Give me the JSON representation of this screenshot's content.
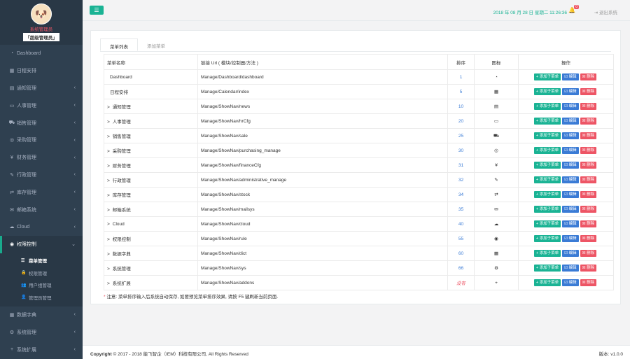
{
  "profile": {
    "name": "系统管理员",
    "role": "「超级管理员」"
  },
  "sidebar": {
    "items": [
      {
        "label": "Dashboard",
        "icon": "dashboard-icon",
        "glyph": "◔",
        "chevron": ""
      },
      {
        "label": "日程安排",
        "icon": "calendar-icon",
        "glyph": "▦",
        "chevron": ""
      },
      {
        "label": "通知管理",
        "icon": "news-icon",
        "glyph": "▤",
        "chevron": "‹"
      },
      {
        "label": "人事管理",
        "icon": "id-card-icon",
        "glyph": "▭",
        "chevron": "‹"
      },
      {
        "label": "销售管理",
        "icon": "cart-icon",
        "glyph": "⛟",
        "chevron": "‹"
      },
      {
        "label": "采购管理",
        "icon": "target-icon",
        "glyph": "◎",
        "chevron": "‹"
      },
      {
        "label": "财务管理",
        "icon": "yen-icon",
        "glyph": "¥",
        "chevron": "‹"
      },
      {
        "label": "行政管理",
        "icon": "plug-icon",
        "glyph": "✎",
        "chevron": "‹"
      },
      {
        "label": "库存管理",
        "icon": "retweet-icon",
        "glyph": "⇄",
        "chevron": "‹"
      },
      {
        "label": "邮箱系统",
        "icon": "envelope-icon",
        "glyph": "✉",
        "chevron": "‹"
      },
      {
        "label": "Cloud",
        "icon": "cloud-icon",
        "glyph": "☁",
        "chevron": "‹"
      },
      {
        "label": "权限控制",
        "icon": "shield-icon",
        "glyph": "◉",
        "chevron": "⌄"
      }
    ],
    "sub_items": [
      {
        "label": "菜单管理",
        "glyph": "☰"
      },
      {
        "label": "权限管理",
        "glyph": "🔒"
      },
      {
        "label": "用户组管理",
        "glyph": "👥"
      },
      {
        "label": "管理员管理",
        "glyph": "👤"
      }
    ],
    "bottom_items": [
      {
        "label": "数据字典",
        "glyph": "▦",
        "chevron": "‹"
      },
      {
        "label": "系统管理",
        "glyph": "⚙",
        "chevron": "‹"
      },
      {
        "label": "系统扩展",
        "glyph": "+",
        "chevron": "‹"
      }
    ]
  },
  "topbar": {
    "menu_glyph": "☰",
    "datetime": "2018 年 08 月 28 日 星期二 11:26:36",
    "badge": "0",
    "logout": "退出系统"
  },
  "tabs": [
    "菜单列表",
    "添加菜单"
  ],
  "table": {
    "headers": [
      "菜单名称",
      "链接 Url ( 模块/控制器/方法 )",
      "排序",
      "图标",
      "操作"
    ],
    "rows": [
      {
        "name": "Dashboard",
        "url": "Manage/Dashboard/dashboard",
        "sort": "1",
        "icon": "◔",
        "arrow": ""
      },
      {
        "name": "日程安排",
        "url": "Manage/Calendar/index",
        "sort": "5",
        "icon": "▦",
        "arrow": ""
      },
      {
        "name": "通知管理",
        "url": "Manage/ShowNav/news",
        "sort": "10",
        "icon": "▤",
        "arrow": ">"
      },
      {
        "name": "人事管理",
        "url": "Manage/ShowNav/hrCfg",
        "sort": "20",
        "icon": "▭",
        "arrow": ">"
      },
      {
        "name": "销售管理",
        "url": "Manage/ShowNav/sale",
        "sort": "25",
        "icon": "⛟",
        "arrow": ">"
      },
      {
        "name": "采购管理",
        "url": "Manage/ShowNav/purchasing_manage",
        "sort": "30",
        "icon": "◎",
        "arrow": ">"
      },
      {
        "name": "财务管理",
        "url": "Manage/ShowNav/financeCfg",
        "sort": "31",
        "icon": "¥",
        "arrow": ">"
      },
      {
        "name": "行政管理",
        "url": "Manage/ShowNav/administrative_manage",
        "sort": "32",
        "icon": "✎",
        "arrow": ">"
      },
      {
        "name": "库存管理",
        "url": "Manage/ShowNav/stock",
        "sort": "34",
        "icon": "⇄",
        "arrow": ">"
      },
      {
        "name": "邮箱系统",
        "url": "Manage/ShowNav/mailsys",
        "sort": "35",
        "icon": "✉",
        "arrow": ">"
      },
      {
        "name": "Cloud",
        "url": "Manage/ShowNav/cloud",
        "sort": "40",
        "icon": "☁",
        "arrow": ">"
      },
      {
        "name": "权限控制",
        "url": "Manage/ShowNav/rule",
        "sort": "55",
        "icon": "◉",
        "arrow": ">"
      },
      {
        "name": "数据字典",
        "url": "Manage/ShowNav/dict",
        "sort": "60",
        "icon": "▦",
        "arrow": ">"
      },
      {
        "name": "系统管理",
        "url": "Manage/ShowNav/sys",
        "sort": "66",
        "icon": "⚙",
        "arrow": ">"
      },
      {
        "name": "系统扩展",
        "url": "Manage/ShowNav/addons",
        "sort": "没有",
        "icon": "+",
        "arrow": ">"
      }
    ],
    "actions": {
      "add": "+ 添加子菜单",
      "edit": "☑ 编辑",
      "delete": "☒ 删除"
    }
  },
  "note": {
    "star": "*",
    "text": " 注意: 菜单排序输入后系统自动保存, 如要预览菜单排序效果, 请按 F5 键刷新当前页面."
  },
  "footer": {
    "copyright_bold": "Copyright",
    "copyright": " © 2017 - 2018 能飞智企（IEM）科技有限公司, All Rights Reserved",
    "version": "版本: v1.0.0"
  },
  "colors": {
    "accent": "#1ab394",
    "sidebar": "#2f4050",
    "danger": "#ed5565",
    "link": "#3a7bd5"
  }
}
